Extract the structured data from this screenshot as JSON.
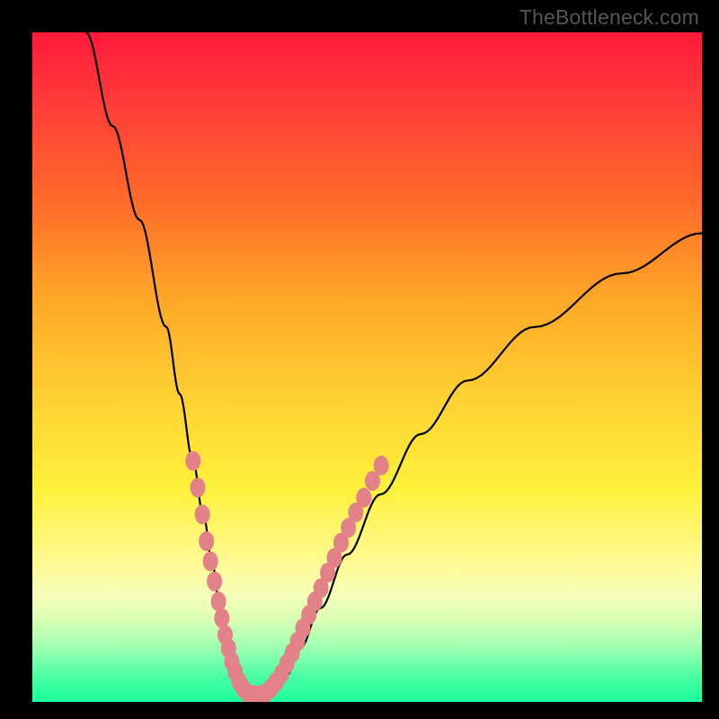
{
  "watermark": "TheBottleneck.com",
  "colors": {
    "frame": "#000000",
    "gradient_top": "#ff1a3a",
    "gradient_bottom": "#1bff9d",
    "curve": "#000000",
    "bead": "#e38188"
  },
  "chart_data": {
    "type": "line",
    "title": "",
    "xlabel": "",
    "ylabel": "",
    "xlim": [
      0,
      100
    ],
    "ylim": [
      0,
      100
    ],
    "series": [
      {
        "name": "bottleneck-curve",
        "x": [
          8,
          12,
          16,
          20,
          22,
          24,
          25.5,
          27,
          28,
          29,
          30,
          31,
          32,
          33,
          34.5,
          36,
          38,
          40,
          43,
          47,
          52,
          58,
          65,
          75,
          88,
          100
        ],
        "values": [
          100,
          86,
          72,
          56,
          46,
          36,
          28,
          20,
          14,
          9,
          5,
          2.5,
          1.3,
          1,
          1.2,
          2,
          4,
          8,
          14,
          22,
          31,
          40,
          48,
          56,
          64,
          70
        ]
      }
    ],
    "beads_left": [
      {
        "x": 24.0,
        "y": 36
      },
      {
        "x": 24.7,
        "y": 32
      },
      {
        "x": 25.4,
        "y": 28
      },
      {
        "x": 26.0,
        "y": 24
      },
      {
        "x": 26.6,
        "y": 21
      },
      {
        "x": 27.2,
        "y": 18
      },
      {
        "x": 27.8,
        "y": 15
      },
      {
        "x": 28.3,
        "y": 12.5
      },
      {
        "x": 28.8,
        "y": 10
      },
      {
        "x": 29.3,
        "y": 8
      },
      {
        "x": 29.8,
        "y": 6
      },
      {
        "x": 30.3,
        "y": 4.5
      },
      {
        "x": 30.9,
        "y": 3
      },
      {
        "x": 31.5,
        "y": 2
      },
      {
        "x": 32.2,
        "y": 1.3
      },
      {
        "x": 33.0,
        "y": 1
      }
    ],
    "beads_right": [
      {
        "x": 34.0,
        "y": 1
      },
      {
        "x": 34.8,
        "y": 1.3
      },
      {
        "x": 35.6,
        "y": 2
      },
      {
        "x": 36.4,
        "y": 3
      },
      {
        "x": 37.2,
        "y": 4.2
      },
      {
        "x": 38.0,
        "y": 5.7
      },
      {
        "x": 38.8,
        "y": 7.3
      },
      {
        "x": 39.6,
        "y": 9
      },
      {
        "x": 40.4,
        "y": 11
      },
      {
        "x": 41.3,
        "y": 13
      },
      {
        "x": 42.2,
        "y": 15
      },
      {
        "x": 43.1,
        "y": 17
      },
      {
        "x": 44.1,
        "y": 19.3
      },
      {
        "x": 45.1,
        "y": 21.5
      },
      {
        "x": 46.1,
        "y": 23.8
      },
      {
        "x": 47.2,
        "y": 26
      },
      {
        "x": 48.3,
        "y": 28.3
      },
      {
        "x": 49.5,
        "y": 30.5
      },
      {
        "x": 50.8,
        "y": 33
      },
      {
        "x": 52.1,
        "y": 35.3
      }
    ]
  }
}
